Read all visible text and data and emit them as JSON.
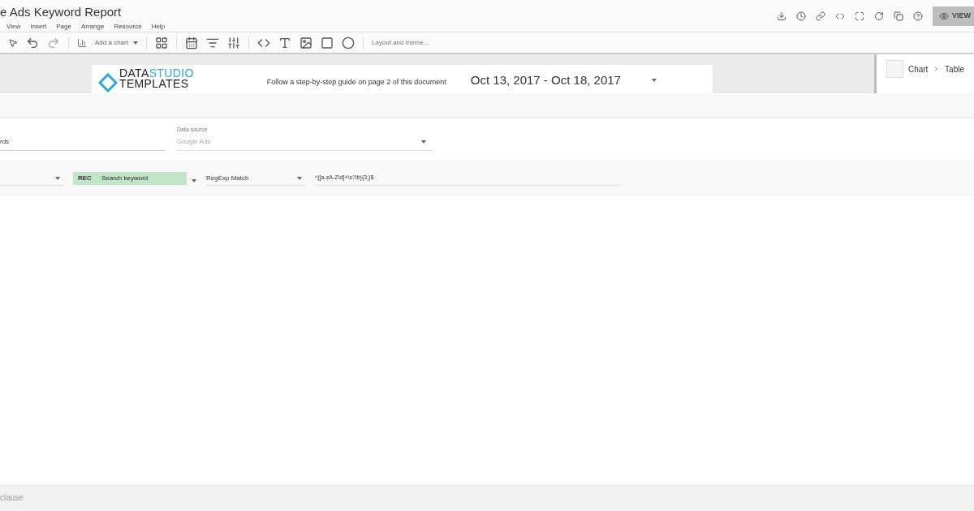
{
  "header": {
    "title": "e Ads Keyword Report",
    "menu": [
      "View",
      "Insert",
      "Page",
      "Arrange",
      "Resource",
      "Help"
    ],
    "view_button": "VIEW"
  },
  "toolbar": {
    "add_chart": "Add a chart",
    "layout_theme": "Layout and theme..."
  },
  "report": {
    "logo_word_1": "DATA",
    "logo_word_2": "STUDIO",
    "logo_line_2": "TEMPLATES",
    "guide": "Follow a step-by-step guide on page 2 of this document",
    "date_range": "Oct 13, 2017 - Oct 18, 2017"
  },
  "side_panel": {
    "breadcrumb_1": "Chart",
    "breadcrumb_2": "Table"
  },
  "filter_dialog": {
    "name_value": "rds",
    "data_source_label": "Data source",
    "data_source_value": "Google Ads",
    "field_tag": "REC",
    "field": "Search keyword",
    "condition": "RegExp Match",
    "expression": "^([a-zA-Z\\d]+\\s?\\b){3,}$",
    "footer": "clause"
  }
}
